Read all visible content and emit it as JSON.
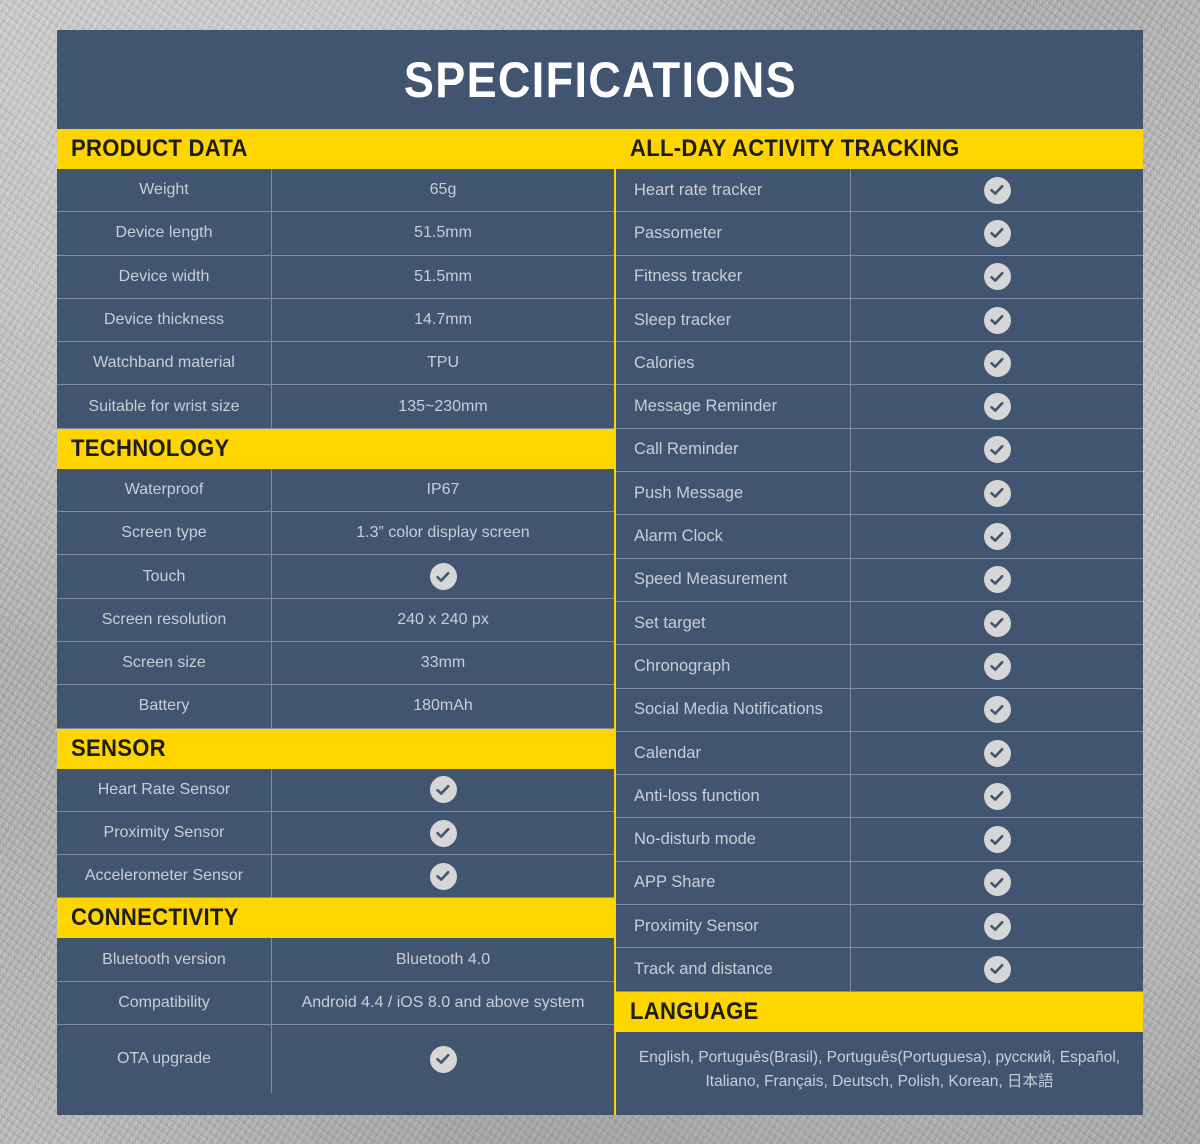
{
  "title": "SPECIFICATIONS",
  "colors": {
    "panel": "#415571",
    "accent_yellow": "#FFD500",
    "text_light": "#C9CED6",
    "header_text": "#1D1D1B",
    "check_circle": "#D6D6D6",
    "divider": "#7D8DA3",
    "background": "#B2B2B2"
  },
  "check_icon": "check-circle-icon",
  "left_column": [
    {
      "section": "PRODUCT DATA",
      "rows": [
        {
          "label": "Weight",
          "value": "65g",
          "type": "text"
        },
        {
          "label": "Device length",
          "value": "51.5mm",
          "type": "text"
        },
        {
          "label": "Device width",
          "value": "51.5mm",
          "type": "text"
        },
        {
          "label": "Device thickness",
          "value": "14.7mm",
          "type": "text"
        },
        {
          "label": "Watchband material",
          "value": "TPU",
          "type": "text"
        },
        {
          "label": "Suitable for wrist size",
          "value": "135~230mm",
          "type": "text"
        }
      ]
    },
    {
      "section": "TECHNOLOGY",
      "rows": [
        {
          "label": "Waterproof",
          "value": "IP67",
          "type": "text"
        },
        {
          "label": "Screen type",
          "value": "1.3” color display screen",
          "type": "text"
        },
        {
          "label": "Touch",
          "value": "",
          "type": "check"
        },
        {
          "label": "Screen resolution",
          "value": "240 x 240 px",
          "type": "text"
        },
        {
          "label": "Screen size",
          "value": "33mm",
          "type": "text"
        },
        {
          "label": "Battery",
          "value": "180mAh",
          "type": "text"
        }
      ]
    },
    {
      "section": "SENSOR",
      "rows": [
        {
          "label": "Heart Rate Sensor",
          "value": "",
          "type": "check"
        },
        {
          "label": "Proximity Sensor",
          "value": "",
          "type": "check"
        },
        {
          "label": "Accelerometer Sensor",
          "value": "",
          "type": "check"
        }
      ]
    },
    {
      "section": "CONNECTIVITY",
      "rows": [
        {
          "label": "Bluetooth version",
          "value": "Bluetooth 4.0",
          "type": "text"
        },
        {
          "label": "Compatibility",
          "value": "Android 4.4 / iOS 8.0 and above system",
          "type": "text"
        },
        {
          "label": "OTA upgrade",
          "value": "",
          "type": "check",
          "tall": true
        }
      ]
    }
  ],
  "right_column": {
    "section": "ALL-DAY ACTIVITY TRACKING",
    "rows": [
      {
        "label": "Heart rate tracker",
        "type": "check"
      },
      {
        "label": "Passometer",
        "type": "check"
      },
      {
        "label": "Fitness tracker",
        "type": "check"
      },
      {
        "label": "Sleep tracker",
        "type": "check"
      },
      {
        "label": "Calories",
        "type": "check"
      },
      {
        "label": "Message Reminder",
        "type": "check"
      },
      {
        "label": "Call Reminder",
        "type": "check"
      },
      {
        "label": "Push Message",
        "type": "check"
      },
      {
        "label": "Alarm Clock",
        "type": "check"
      },
      {
        "label": "Speed Measurement",
        "type": "check"
      },
      {
        "label": "Set target",
        "type": "check"
      },
      {
        "label": "Chronograph",
        "type": "check"
      },
      {
        "label": "Social Media Notifications",
        "type": "check"
      },
      {
        "label": "Calendar",
        "type": "check"
      },
      {
        "label": "Anti-loss function",
        "type": "check"
      },
      {
        "label": "No-disturb mode",
        "type": "check"
      },
      {
        "label": "APP  Share",
        "type": "check"
      },
      {
        "label": "Proximity Sensor",
        "type": "check"
      },
      {
        "label": "Track and distance",
        "type": "check"
      }
    ],
    "language": {
      "section": "LANGUAGE",
      "line1": "English, Português(Brasil), Português(Portuguesa),  русский, Español,",
      "line2": "Italiano, Français, Deutsch, Polish,  Korean,  日本語"
    }
  }
}
